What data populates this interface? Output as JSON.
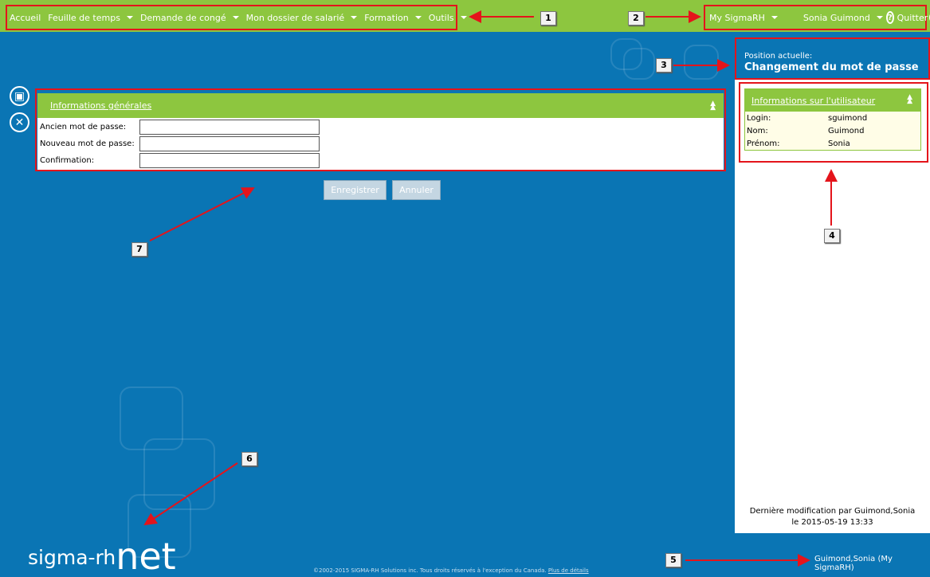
{
  "topbar": {
    "menu": [
      {
        "label": "Accueil",
        "caret": false
      },
      {
        "label": "Feuille de temps",
        "caret": true
      },
      {
        "label": "Demande de congé",
        "caret": true
      },
      {
        "label": "Mon dossier de salarié",
        "caret": true
      },
      {
        "label": "Formation",
        "caret": true
      },
      {
        "label": "Outils",
        "caret": true
      }
    ],
    "my_sigmarh": "My SigmaRH",
    "user_name": "Sonia Guimond",
    "help_icon": "question-circle-icon",
    "quit": "Quitter",
    "quit_icon": "power-icon"
  },
  "callouts": [
    "1",
    "2",
    "3",
    "4",
    "5",
    "6",
    "7"
  ],
  "position": {
    "label": "Position actuelle:",
    "title": "Changement du mot de passe"
  },
  "user_info": {
    "title": "Informations sur l'utilisateur",
    "rows": [
      {
        "key": "Login:",
        "value": "sguimond"
      },
      {
        "key": "Nom:",
        "value": "Guimond"
      },
      {
        "key": "Prénom:",
        "value": "Sonia"
      }
    ]
  },
  "last_modified": {
    "line1": "Dernière modification par Guimond,Sonia",
    "line2": "le 2015-05-19 13:33"
  },
  "form": {
    "title": "Informations générales",
    "fields": [
      {
        "label": "Ancien mot de passe:",
        "value": ""
      },
      {
        "label": "Nouveau mot de passe:",
        "value": ""
      },
      {
        "label": "Confirmation:",
        "value": ""
      }
    ],
    "save_label": "Enregistrer",
    "cancel_label": "Annuler"
  },
  "side_icons": {
    "save": "save-icon",
    "close": "close-icon"
  },
  "footer": {
    "logo_prefix": "sigma-rh",
    "logo_suffix": "net",
    "copyright": "©2002-2015 SIGMA-RH Solutions inc. Tous droits réservés à l'exception du Canada.",
    "details_link": "Plus de détails",
    "user": "Guimond,Sonia (My SigmaRH)"
  },
  "colors": {
    "brand_green": "#8dc63f",
    "background_blue": "#0a75b4",
    "annotation_red": "#e4141b"
  }
}
